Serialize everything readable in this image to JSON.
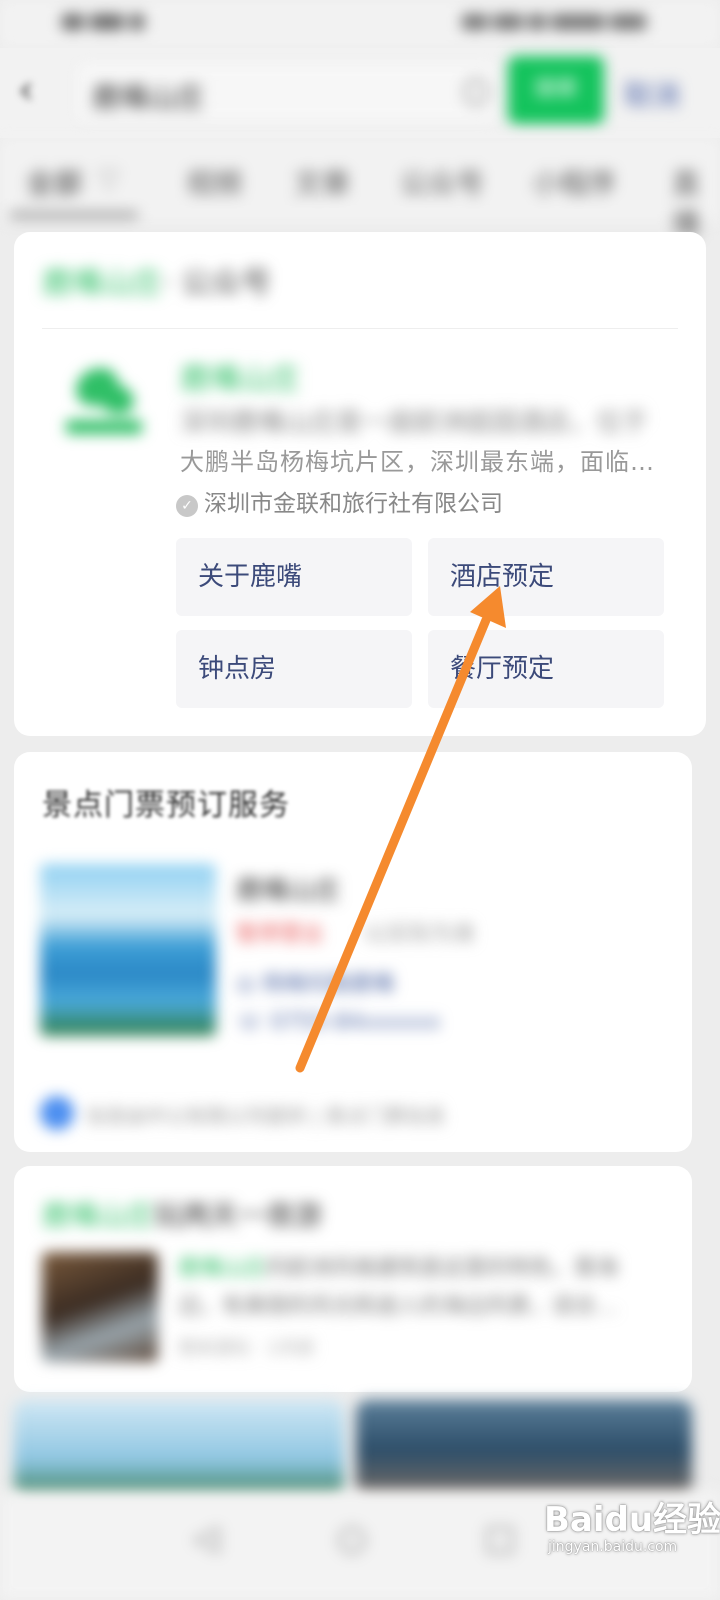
{
  "status_bar": {
    "left": "",
    "right": ""
  },
  "header": {
    "back_icon": "back-arrow-icon",
    "query": "鹿嘴山庄",
    "search_label": "搜索",
    "cancel_label": "取消"
  },
  "tabs": [
    "全部",
    "视频",
    "文章",
    "公众号",
    "小程序",
    "直播"
  ],
  "account_card": {
    "title_green": "鹿嘴山庄",
    "title_rest": "· 公众号",
    "name": "鹿嘴山庄",
    "desc_line1": "深圳鹿嘴山庄是一座欧洲庭园酒店，位于",
    "desc_line2": "大鹏半岛杨梅坑片区，深圳最东端，面临大海…",
    "company": "深圳市金联和旅行社有限公司",
    "menu": [
      "关于鹿嘴",
      "酒店预定",
      "钟点房",
      "餐厅预定"
    ]
  },
  "ticket_card": {
    "title": "景点门票预订服务",
    "poi_name": "鹿嘴山庄",
    "poi_tag": "暂停营业",
    "poi_tag2": "·以实际为准",
    "address": "杨梅坑路鹿嘴",
    "phone": "0755-84xxxxxx",
    "info": "信息由中公有限公司提供 | 景点门票信息"
  },
  "article_card": {
    "title_green": "鹿嘴山庄",
    "title_rest": "玩两天一夜游",
    "text_green": "鹿嘴山庄",
    "text_line1": "的欧洲风格建筑是这里的特色，靠海",
    "text_line2": "边，有美丽的风光和迷人的海边风景，适合…",
    "meta": "周末游玩 · 1天前"
  },
  "watermark": {
    "main": "Baidu经验",
    "sub": "jingyan.baidu.com"
  },
  "colors": {
    "accent_green": "#13c35c",
    "link_blue": "#4b63a8",
    "annotation_arrow": "#f58a2e"
  }
}
